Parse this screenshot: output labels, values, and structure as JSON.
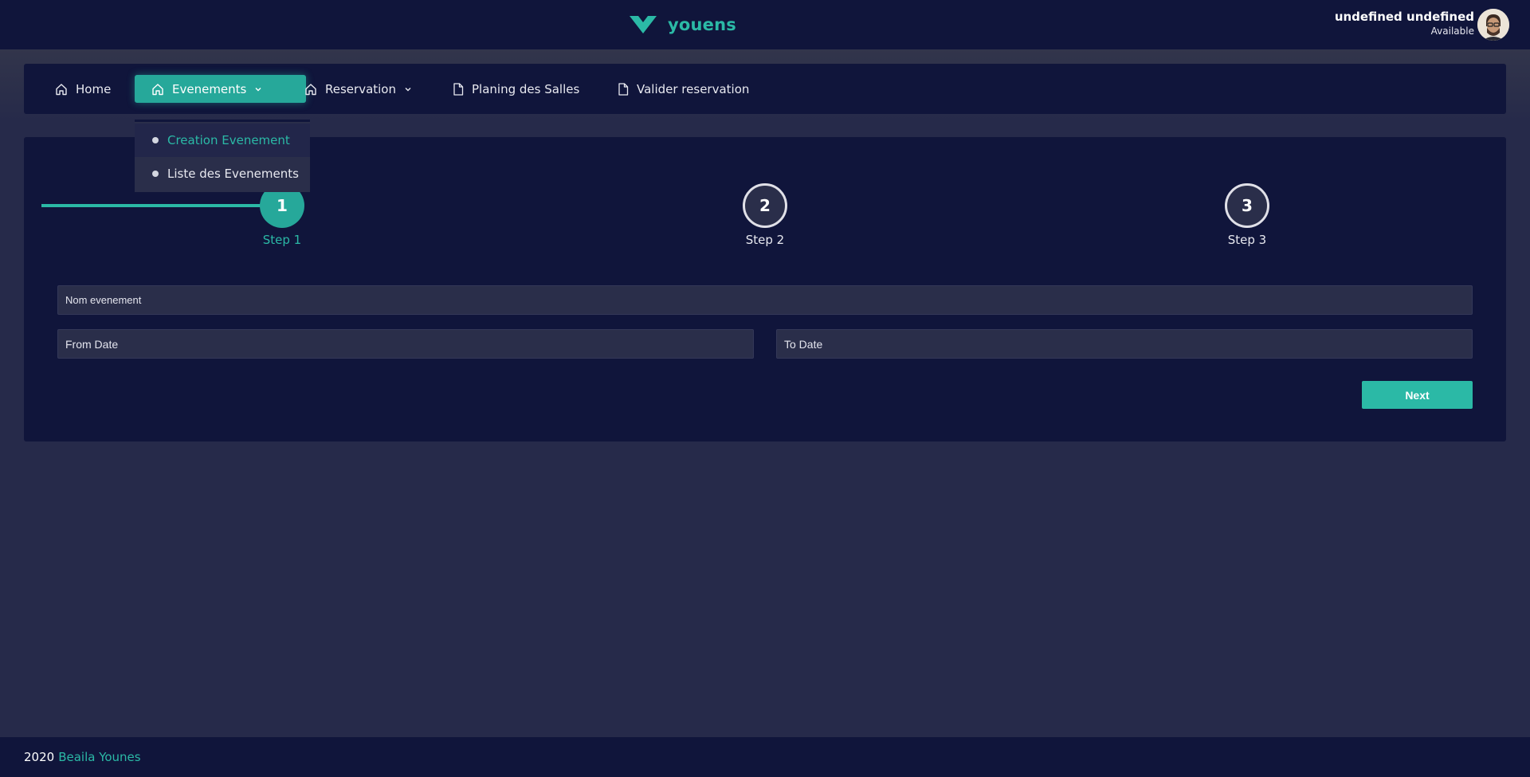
{
  "header": {
    "brand_name": "youens",
    "user_name": "undefined undefined",
    "user_status": "Available"
  },
  "nav": {
    "items": [
      {
        "label": "Home",
        "icon": "home-icon"
      },
      {
        "label": "Evenements",
        "icon": "home-icon",
        "active": true,
        "has_dropdown": true
      },
      {
        "label": "Reservation",
        "icon": "home-icon",
        "has_dropdown": true
      },
      {
        "label": "Planing des Salles",
        "icon": "document-icon"
      },
      {
        "label": "Valider reservation",
        "icon": "document-icon"
      }
    ],
    "dropdown": [
      {
        "label": "Creation Evenement",
        "current": true
      },
      {
        "label": "Liste des Evenements"
      }
    ]
  },
  "wizard": {
    "steps": [
      {
        "number": "1",
        "label": "Step 1",
        "state": "done"
      },
      {
        "number": "2",
        "label": "Step 2",
        "state": "todo"
      },
      {
        "number": "3",
        "label": "Step 3",
        "state": "todo"
      }
    ],
    "fields": {
      "name_placeholder": "Nom evenement",
      "from_placeholder": "From Date",
      "to_placeholder": "To Date"
    },
    "next_label": "Next"
  },
  "footer": {
    "year": "2020",
    "author": "Beaila Younes"
  },
  "colors": {
    "accent": "#2bb9a6",
    "header_bg": "#10153b",
    "page_bg": "#262a4a"
  }
}
